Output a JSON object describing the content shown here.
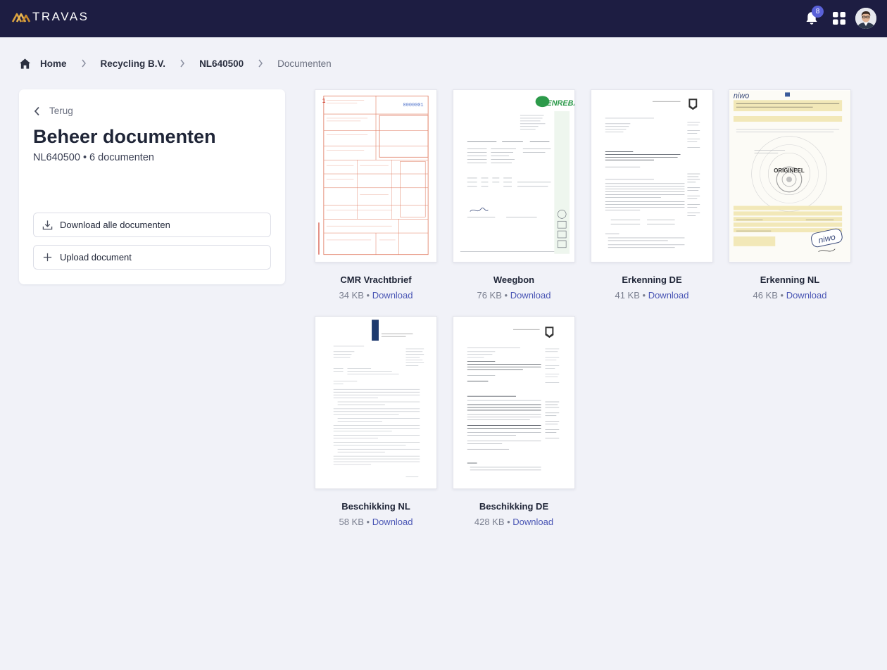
{
  "app": {
    "brand": "TRAVAS"
  },
  "header": {
    "notification_count": "8"
  },
  "breadcrumb": {
    "home": "Home",
    "company": "Recycling B.V.",
    "location": "NL640500",
    "current": "Documenten"
  },
  "panel": {
    "back_label": "Terug",
    "title": "Beheer documenten",
    "subtitle": "NL640500 • 6 documenten",
    "download_all_label": "Download alle documenten",
    "upload_label": "Upload document"
  },
  "documents": [
    {
      "name": "CMR Vrachtbrief",
      "size": "34 KB",
      "sep": " • ",
      "action": "Download"
    },
    {
      "name": "Weegbon",
      "size": "76 KB",
      "sep": " • ",
      "action": "Download"
    },
    {
      "name": "Erkenning DE",
      "size": "41 KB",
      "sep": " • ",
      "action": "Download"
    },
    {
      "name": "Erkenning NL",
      "size": "46 KB",
      "sep": " • ",
      "action": "Download"
    },
    {
      "name": "Beschikking NL",
      "size": "58 KB",
      "sep": " • ",
      "action": "Download"
    },
    {
      "name": "Beschikking DE",
      "size": "428 KB",
      "sep": " • ",
      "action": "Download"
    }
  ],
  "thumbnails": {
    "cmr": {
      "doc_number": "0000001"
    },
    "weegbon": {
      "brand": "ENREBA"
    },
    "erkenning_nl": {
      "brand": "niwo",
      "stamp": "ORIGINEEL"
    }
  },
  "icons": {
    "logo": "travas-logo-icon",
    "bell": "bell-icon",
    "apps": "apps-grid-icon",
    "home": "home-icon",
    "chevron": "chevron-right-icon",
    "back": "chevron-left-icon",
    "download": "download-icon",
    "plus": "plus-icon"
  },
  "colors": {
    "topbar": "#1d1d42",
    "background": "#f1f2f8",
    "accent": "#4a56b5",
    "badge": "#5a61d8",
    "logo": "#d9a13e"
  }
}
